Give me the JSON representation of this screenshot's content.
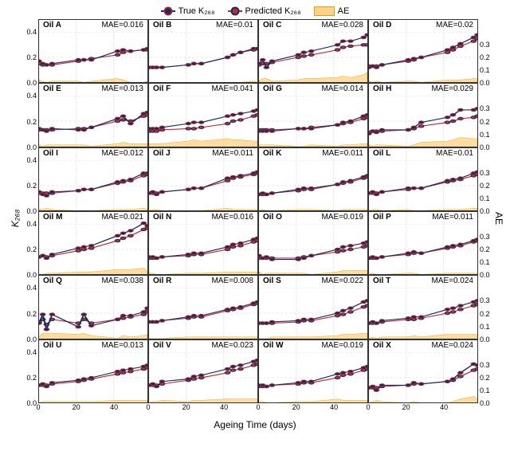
{
  "legend": {
    "true_label": "True K₂₆₈",
    "pred_label": "Predicted K₂₆₈",
    "ae_label": "AE"
  },
  "axes": {
    "xlabel": "Ageing Time (days)",
    "ylabel_left": "K₂₆₈",
    "ylabel_right": "AE",
    "xlim": [
      0,
      58
    ],
    "ylim_left": [
      0.0,
      0.5
    ],
    "ylim_right": [
      0.0,
      0.5
    ],
    "xticks": [
      0,
      20,
      40
    ],
    "yticks_left": [
      "0.0",
      "0.2",
      "0.4"
    ],
    "yticks_right": [
      "0.0",
      "0.1",
      "0.2",
      "0.3"
    ]
  },
  "chart_data": {
    "type": "grid-of-line-charts",
    "rows": 6,
    "cols": 4,
    "shared_x": [
      0,
      2,
      4,
      7,
      21,
      24,
      28,
      42,
      45,
      49,
      56,
      58
    ],
    "panels": [
      {
        "id": "A",
        "title": "Oil A",
        "mae": "MAE=0.016",
        "true": [
          0.17,
          0.15,
          0.14,
          0.15,
          0.18,
          0.18,
          0.18,
          0.25,
          0.26,
          0.25,
          0.26,
          0.27
        ],
        "pred": [
          0.15,
          0.14,
          0.14,
          0.14,
          0.17,
          0.18,
          0.19,
          0.22,
          0.24,
          0.25,
          0.26,
          0.26
        ],
        "ae": [
          0.02,
          0.01,
          0.0,
          0.01,
          0.01,
          0.0,
          0.01,
          0.03,
          0.02,
          0.0,
          0.0,
          0.01
        ]
      },
      {
        "id": "B",
        "title": "Oil B",
        "mae": "MAE=0.01",
        "true": [
          0.12,
          0.12,
          0.12,
          0.12,
          0.14,
          0.15,
          0.15,
          0.2,
          0.22,
          0.24,
          0.27,
          0.27
        ],
        "pred": [
          0.12,
          0.12,
          0.12,
          0.12,
          0.14,
          0.15,
          0.15,
          0.2,
          0.22,
          0.24,
          0.26,
          0.27
        ],
        "ae": [
          0.0,
          0.0,
          0.0,
          0.0,
          0.0,
          0.0,
          0.0,
          0.0,
          0.0,
          0.0,
          0.01,
          0.0
        ]
      },
      {
        "id": "C",
        "title": "Oil C",
        "mae": "MAE=0.028",
        "true": [
          0.15,
          0.18,
          0.12,
          0.17,
          0.22,
          0.24,
          0.25,
          0.3,
          0.33,
          0.33,
          0.36,
          0.38
        ],
        "pred": [
          0.14,
          0.15,
          0.15,
          0.16,
          0.2,
          0.21,
          0.22,
          0.26,
          0.28,
          0.29,
          0.3,
          0.3
        ],
        "ae": [
          0.01,
          0.03,
          0.03,
          0.01,
          0.02,
          0.03,
          0.03,
          0.04,
          0.05,
          0.04,
          0.06,
          0.08
        ]
      },
      {
        "id": "D",
        "title": "Oil D",
        "mae": "MAE=0.02",
        "true": [
          0.12,
          0.13,
          0.12,
          0.14,
          0.18,
          0.19,
          0.2,
          0.26,
          0.28,
          0.31,
          0.36,
          0.38
        ],
        "pred": [
          0.13,
          0.13,
          0.13,
          0.14,
          0.17,
          0.18,
          0.2,
          0.24,
          0.26,
          0.29,
          0.33,
          0.35
        ],
        "ae": [
          0.01,
          0.0,
          0.01,
          0.0,
          0.01,
          0.01,
          0.0,
          0.02,
          0.02,
          0.02,
          0.03,
          0.03
        ]
      },
      {
        "id": "E",
        "title": "Oil E",
        "mae": "MAE=0.013",
        "true": [
          0.14,
          0.13,
          0.12,
          0.14,
          0.13,
          0.13,
          0.15,
          0.22,
          0.24,
          0.18,
          0.26,
          0.27
        ],
        "pred": [
          0.13,
          0.13,
          0.13,
          0.13,
          0.14,
          0.14,
          0.15,
          0.2,
          0.21,
          0.2,
          0.24,
          0.25
        ],
        "ae": [
          0.01,
          0.0,
          0.01,
          0.01,
          0.01,
          0.01,
          0.0,
          0.02,
          0.03,
          0.02,
          0.02,
          0.02
        ]
      },
      {
        "id": "F",
        "title": "Oil F",
        "mae": "MAE=0.041",
        "true": [
          0.14,
          0.14,
          0.14,
          0.15,
          0.18,
          0.19,
          0.19,
          0.24,
          0.25,
          0.26,
          0.28,
          0.29
        ],
        "pred": [
          0.12,
          0.12,
          0.12,
          0.13,
          0.14,
          0.14,
          0.15,
          0.18,
          0.2,
          0.21,
          0.24,
          0.25
        ],
        "ae": [
          0.02,
          0.02,
          0.02,
          0.02,
          0.04,
          0.05,
          0.04,
          0.06,
          0.05,
          0.05,
          0.04,
          0.04
        ]
      },
      {
        "id": "G",
        "title": "Oil G",
        "mae": "MAE=0.014",
        "true": [
          0.12,
          0.12,
          0.12,
          0.12,
          0.14,
          0.14,
          0.14,
          0.17,
          0.19,
          0.2,
          0.24,
          0.25
        ],
        "pred": [
          0.13,
          0.13,
          0.13,
          0.13,
          0.14,
          0.14,
          0.15,
          0.17,
          0.18,
          0.19,
          0.22,
          0.23
        ],
        "ae": [
          0.01,
          0.01,
          0.01,
          0.01,
          0.0,
          0.0,
          0.01,
          0.0,
          0.01,
          0.01,
          0.02,
          0.02
        ]
      },
      {
        "id": "H",
        "title": "Oil H",
        "mae": "MAE=0.029",
        "true": [
          0.1,
          0.12,
          0.11,
          0.13,
          0.13,
          0.15,
          0.19,
          0.23,
          0.25,
          0.29,
          0.29,
          0.3
        ],
        "pred": [
          0.11,
          0.12,
          0.12,
          0.12,
          0.13,
          0.14,
          0.16,
          0.19,
          0.2,
          0.22,
          0.23,
          0.24
        ],
        "ae": [
          0.01,
          0.0,
          0.01,
          0.01,
          0.0,
          0.01,
          0.03,
          0.04,
          0.05,
          0.07,
          0.06,
          0.06
        ]
      },
      {
        "id": "I",
        "title": "Oil I",
        "mae": "MAE=0.012",
        "true": [
          0.15,
          0.13,
          0.12,
          0.15,
          0.16,
          0.17,
          0.17,
          0.23,
          0.24,
          0.25,
          0.3,
          0.3
        ],
        "pred": [
          0.14,
          0.14,
          0.14,
          0.14,
          0.16,
          0.17,
          0.17,
          0.22,
          0.23,
          0.24,
          0.28,
          0.29
        ],
        "ae": [
          0.01,
          0.01,
          0.02,
          0.01,
          0.0,
          0.0,
          0.0,
          0.01,
          0.01,
          0.01,
          0.02,
          0.01
        ]
      },
      {
        "id": "J",
        "title": "Oil J",
        "mae": "MAE=0.011",
        "true": [
          0.14,
          0.15,
          0.13,
          0.15,
          0.17,
          0.18,
          0.18,
          0.26,
          0.27,
          0.28,
          0.3,
          0.31
        ],
        "pred": [
          0.14,
          0.14,
          0.14,
          0.15,
          0.17,
          0.18,
          0.18,
          0.24,
          0.26,
          0.27,
          0.29,
          0.3
        ],
        "ae": [
          0.0,
          0.01,
          0.01,
          0.0,
          0.0,
          0.0,
          0.0,
          0.02,
          0.01,
          0.01,
          0.01,
          0.01
        ]
      },
      {
        "id": "K",
        "title": "Oil K",
        "mae": "MAE=0.011",
        "true": [
          0.13,
          0.14,
          0.13,
          0.14,
          0.17,
          0.18,
          0.18,
          0.21,
          0.23,
          0.24,
          0.27,
          0.28
        ],
        "pred": [
          0.13,
          0.13,
          0.13,
          0.14,
          0.16,
          0.17,
          0.17,
          0.21,
          0.22,
          0.23,
          0.26,
          0.27
        ],
        "ae": [
          0.0,
          0.01,
          0.0,
          0.0,
          0.01,
          0.01,
          0.01,
          0.0,
          0.01,
          0.01,
          0.01,
          0.01
        ]
      },
      {
        "id": "L",
        "title": "Oil L",
        "mae": "MAE=0.01",
        "true": [
          0.14,
          0.15,
          0.13,
          0.15,
          0.18,
          0.18,
          0.18,
          0.24,
          0.25,
          0.26,
          0.3,
          0.31
        ],
        "pred": [
          0.14,
          0.14,
          0.14,
          0.15,
          0.17,
          0.18,
          0.18,
          0.23,
          0.24,
          0.25,
          0.28,
          0.29
        ],
        "ae": [
          0.0,
          0.01,
          0.01,
          0.0,
          0.01,
          0.0,
          0.0,
          0.01,
          0.01,
          0.01,
          0.02,
          0.02
        ]
      },
      {
        "id": "M",
        "title": "Oil M",
        "mae": "MAE=0.021",
        "true": [
          0.14,
          0.15,
          0.13,
          0.16,
          0.21,
          0.22,
          0.23,
          0.31,
          0.33,
          0.35,
          0.41,
          0.39
        ],
        "pred": [
          0.14,
          0.15,
          0.14,
          0.15,
          0.19,
          0.2,
          0.21,
          0.27,
          0.29,
          0.31,
          0.36,
          0.37
        ],
        "ae": [
          0.0,
          0.0,
          0.01,
          0.01,
          0.02,
          0.02,
          0.02,
          0.04,
          0.04,
          0.04,
          0.05,
          0.02
        ]
      },
      {
        "id": "N",
        "title": "Oil N",
        "mae": "MAE=0.016",
        "true": [
          0.14,
          0.14,
          0.13,
          0.14,
          0.16,
          0.17,
          0.17,
          0.22,
          0.24,
          0.25,
          0.28,
          0.29
        ],
        "pred": [
          0.13,
          0.13,
          0.13,
          0.14,
          0.15,
          0.16,
          0.16,
          0.2,
          0.22,
          0.23,
          0.26,
          0.27
        ],
        "ae": [
          0.01,
          0.01,
          0.0,
          0.0,
          0.01,
          0.01,
          0.01,
          0.02,
          0.02,
          0.02,
          0.02,
          0.02
        ]
      },
      {
        "id": "O",
        "title": "Oil O",
        "mae": "MAE=0.019",
        "true": [
          0.15,
          0.13,
          0.14,
          0.12,
          0.12,
          0.13,
          0.15,
          0.2,
          0.22,
          0.23,
          0.25,
          0.26
        ],
        "pred": [
          0.13,
          0.13,
          0.13,
          0.13,
          0.13,
          0.14,
          0.15,
          0.18,
          0.19,
          0.2,
          0.22,
          0.23
        ],
        "ae": [
          0.02,
          0.0,
          0.01,
          0.01,
          0.01,
          0.01,
          0.0,
          0.02,
          0.03,
          0.03,
          0.03,
          0.03
        ]
      },
      {
        "id": "P",
        "title": "Oil P",
        "mae": "MAE=0.011",
        "true": [
          0.13,
          0.14,
          0.13,
          0.14,
          0.17,
          0.18,
          0.17,
          0.22,
          0.23,
          0.24,
          0.27,
          0.28
        ],
        "pred": [
          0.13,
          0.13,
          0.13,
          0.14,
          0.16,
          0.17,
          0.17,
          0.21,
          0.22,
          0.23,
          0.26,
          0.27
        ],
        "ae": [
          0.0,
          0.01,
          0.0,
          0.0,
          0.01,
          0.01,
          0.0,
          0.01,
          0.01,
          0.01,
          0.01,
          0.01
        ]
      },
      {
        "id": "Q",
        "title": "Oil Q",
        "mae": "MAE=0.038",
        "true": [
          0.12,
          0.19,
          0.07,
          0.19,
          0.09,
          0.19,
          0.1,
          0.15,
          0.18,
          0.18,
          0.21,
          0.24
        ],
        "pred": [
          0.13,
          0.15,
          0.11,
          0.15,
          0.12,
          0.15,
          0.12,
          0.15,
          0.16,
          0.17,
          0.19,
          0.21
        ],
        "ae": [
          0.01,
          0.04,
          0.04,
          0.04,
          0.03,
          0.04,
          0.02,
          0.0,
          0.02,
          0.01,
          0.02,
          0.03
        ]
      },
      {
        "id": "R",
        "title": "Oil R",
        "mae": "MAE=0.008",
        "true": [
          0.13,
          0.13,
          0.13,
          0.14,
          0.17,
          0.18,
          0.18,
          0.23,
          0.24,
          0.25,
          0.28,
          0.29
        ],
        "pred": [
          0.13,
          0.13,
          0.13,
          0.14,
          0.16,
          0.17,
          0.17,
          0.22,
          0.23,
          0.24,
          0.27,
          0.28
        ],
        "ae": [
          0.0,
          0.0,
          0.0,
          0.0,
          0.01,
          0.01,
          0.01,
          0.01,
          0.01,
          0.01,
          0.01,
          0.01
        ]
      },
      {
        "id": "S",
        "title": "Oil S",
        "mae": "MAE=0.022",
        "true": [
          0.12,
          0.12,
          0.12,
          0.13,
          0.14,
          0.15,
          0.15,
          0.2,
          0.22,
          0.24,
          0.29,
          0.3
        ],
        "pred": [
          0.12,
          0.12,
          0.12,
          0.12,
          0.13,
          0.14,
          0.14,
          0.18,
          0.19,
          0.21,
          0.25,
          0.26
        ],
        "ae": [
          0.0,
          0.0,
          0.0,
          0.01,
          0.01,
          0.01,
          0.01,
          0.02,
          0.03,
          0.03,
          0.04,
          0.04
        ]
      },
      {
        "id": "T",
        "title": "Oil T",
        "mae": "MAE=0.024",
        "true": [
          0.12,
          0.13,
          0.12,
          0.14,
          0.16,
          0.17,
          0.17,
          0.23,
          0.24,
          0.26,
          0.29,
          0.3
        ],
        "pred": [
          0.12,
          0.12,
          0.12,
          0.13,
          0.15,
          0.15,
          0.16,
          0.2,
          0.21,
          0.23,
          0.26,
          0.27
        ],
        "ae": [
          0.0,
          0.01,
          0.0,
          0.01,
          0.01,
          0.02,
          0.01,
          0.03,
          0.03,
          0.03,
          0.03,
          0.03
        ]
      },
      {
        "id": "U",
        "title": "Oil U",
        "mae": "MAE=0.013",
        "true": [
          0.14,
          0.15,
          0.13,
          0.16,
          0.18,
          0.19,
          0.2,
          0.25,
          0.26,
          0.27,
          0.29,
          0.3
        ],
        "pred": [
          0.14,
          0.14,
          0.14,
          0.15,
          0.17,
          0.18,
          0.19,
          0.23,
          0.24,
          0.25,
          0.27,
          0.28
        ],
        "ae": [
          0.0,
          0.01,
          0.01,
          0.01,
          0.01,
          0.01,
          0.01,
          0.02,
          0.02,
          0.02,
          0.02,
          0.02
        ]
      },
      {
        "id": "V",
        "title": "Oil V",
        "mae": "MAE=0.023",
        "true": [
          0.14,
          0.15,
          0.13,
          0.17,
          0.19,
          0.21,
          0.22,
          0.27,
          0.29,
          0.3,
          0.33,
          0.34
        ],
        "pred": [
          0.14,
          0.14,
          0.14,
          0.15,
          0.18,
          0.19,
          0.2,
          0.24,
          0.26,
          0.27,
          0.3,
          0.31
        ],
        "ae": [
          0.0,
          0.01,
          0.01,
          0.02,
          0.01,
          0.02,
          0.02,
          0.03,
          0.03,
          0.03,
          0.03,
          0.03
        ]
      },
      {
        "id": "W",
        "title": "Oil W",
        "mae": "MAE=0.019",
        "true": [
          0.14,
          0.14,
          0.13,
          0.14,
          0.16,
          0.17,
          0.17,
          0.23,
          0.24,
          0.25,
          0.28,
          0.29
        ],
        "pred": [
          0.13,
          0.13,
          0.13,
          0.14,
          0.15,
          0.16,
          0.16,
          0.2,
          0.22,
          0.23,
          0.26,
          0.27
        ],
        "ae": [
          0.01,
          0.01,
          0.0,
          0.0,
          0.01,
          0.01,
          0.01,
          0.03,
          0.02,
          0.02,
          0.02,
          0.02
        ]
      },
      {
        "id": "X",
        "title": "Oil X",
        "mae": "MAE=0.024",
        "true": [
          0.12,
          0.13,
          0.1,
          0.14,
          0.14,
          0.16,
          0.15,
          0.17,
          0.19,
          0.24,
          0.31,
          0.3
        ],
        "pred": [
          0.12,
          0.12,
          0.12,
          0.13,
          0.14,
          0.15,
          0.15,
          0.17,
          0.18,
          0.21,
          0.26,
          0.27
        ],
        "ae": [
          0.0,
          0.01,
          0.02,
          0.01,
          0.0,
          0.01,
          0.0,
          0.0,
          0.01,
          0.03,
          0.05,
          0.03
        ]
      }
    ]
  }
}
